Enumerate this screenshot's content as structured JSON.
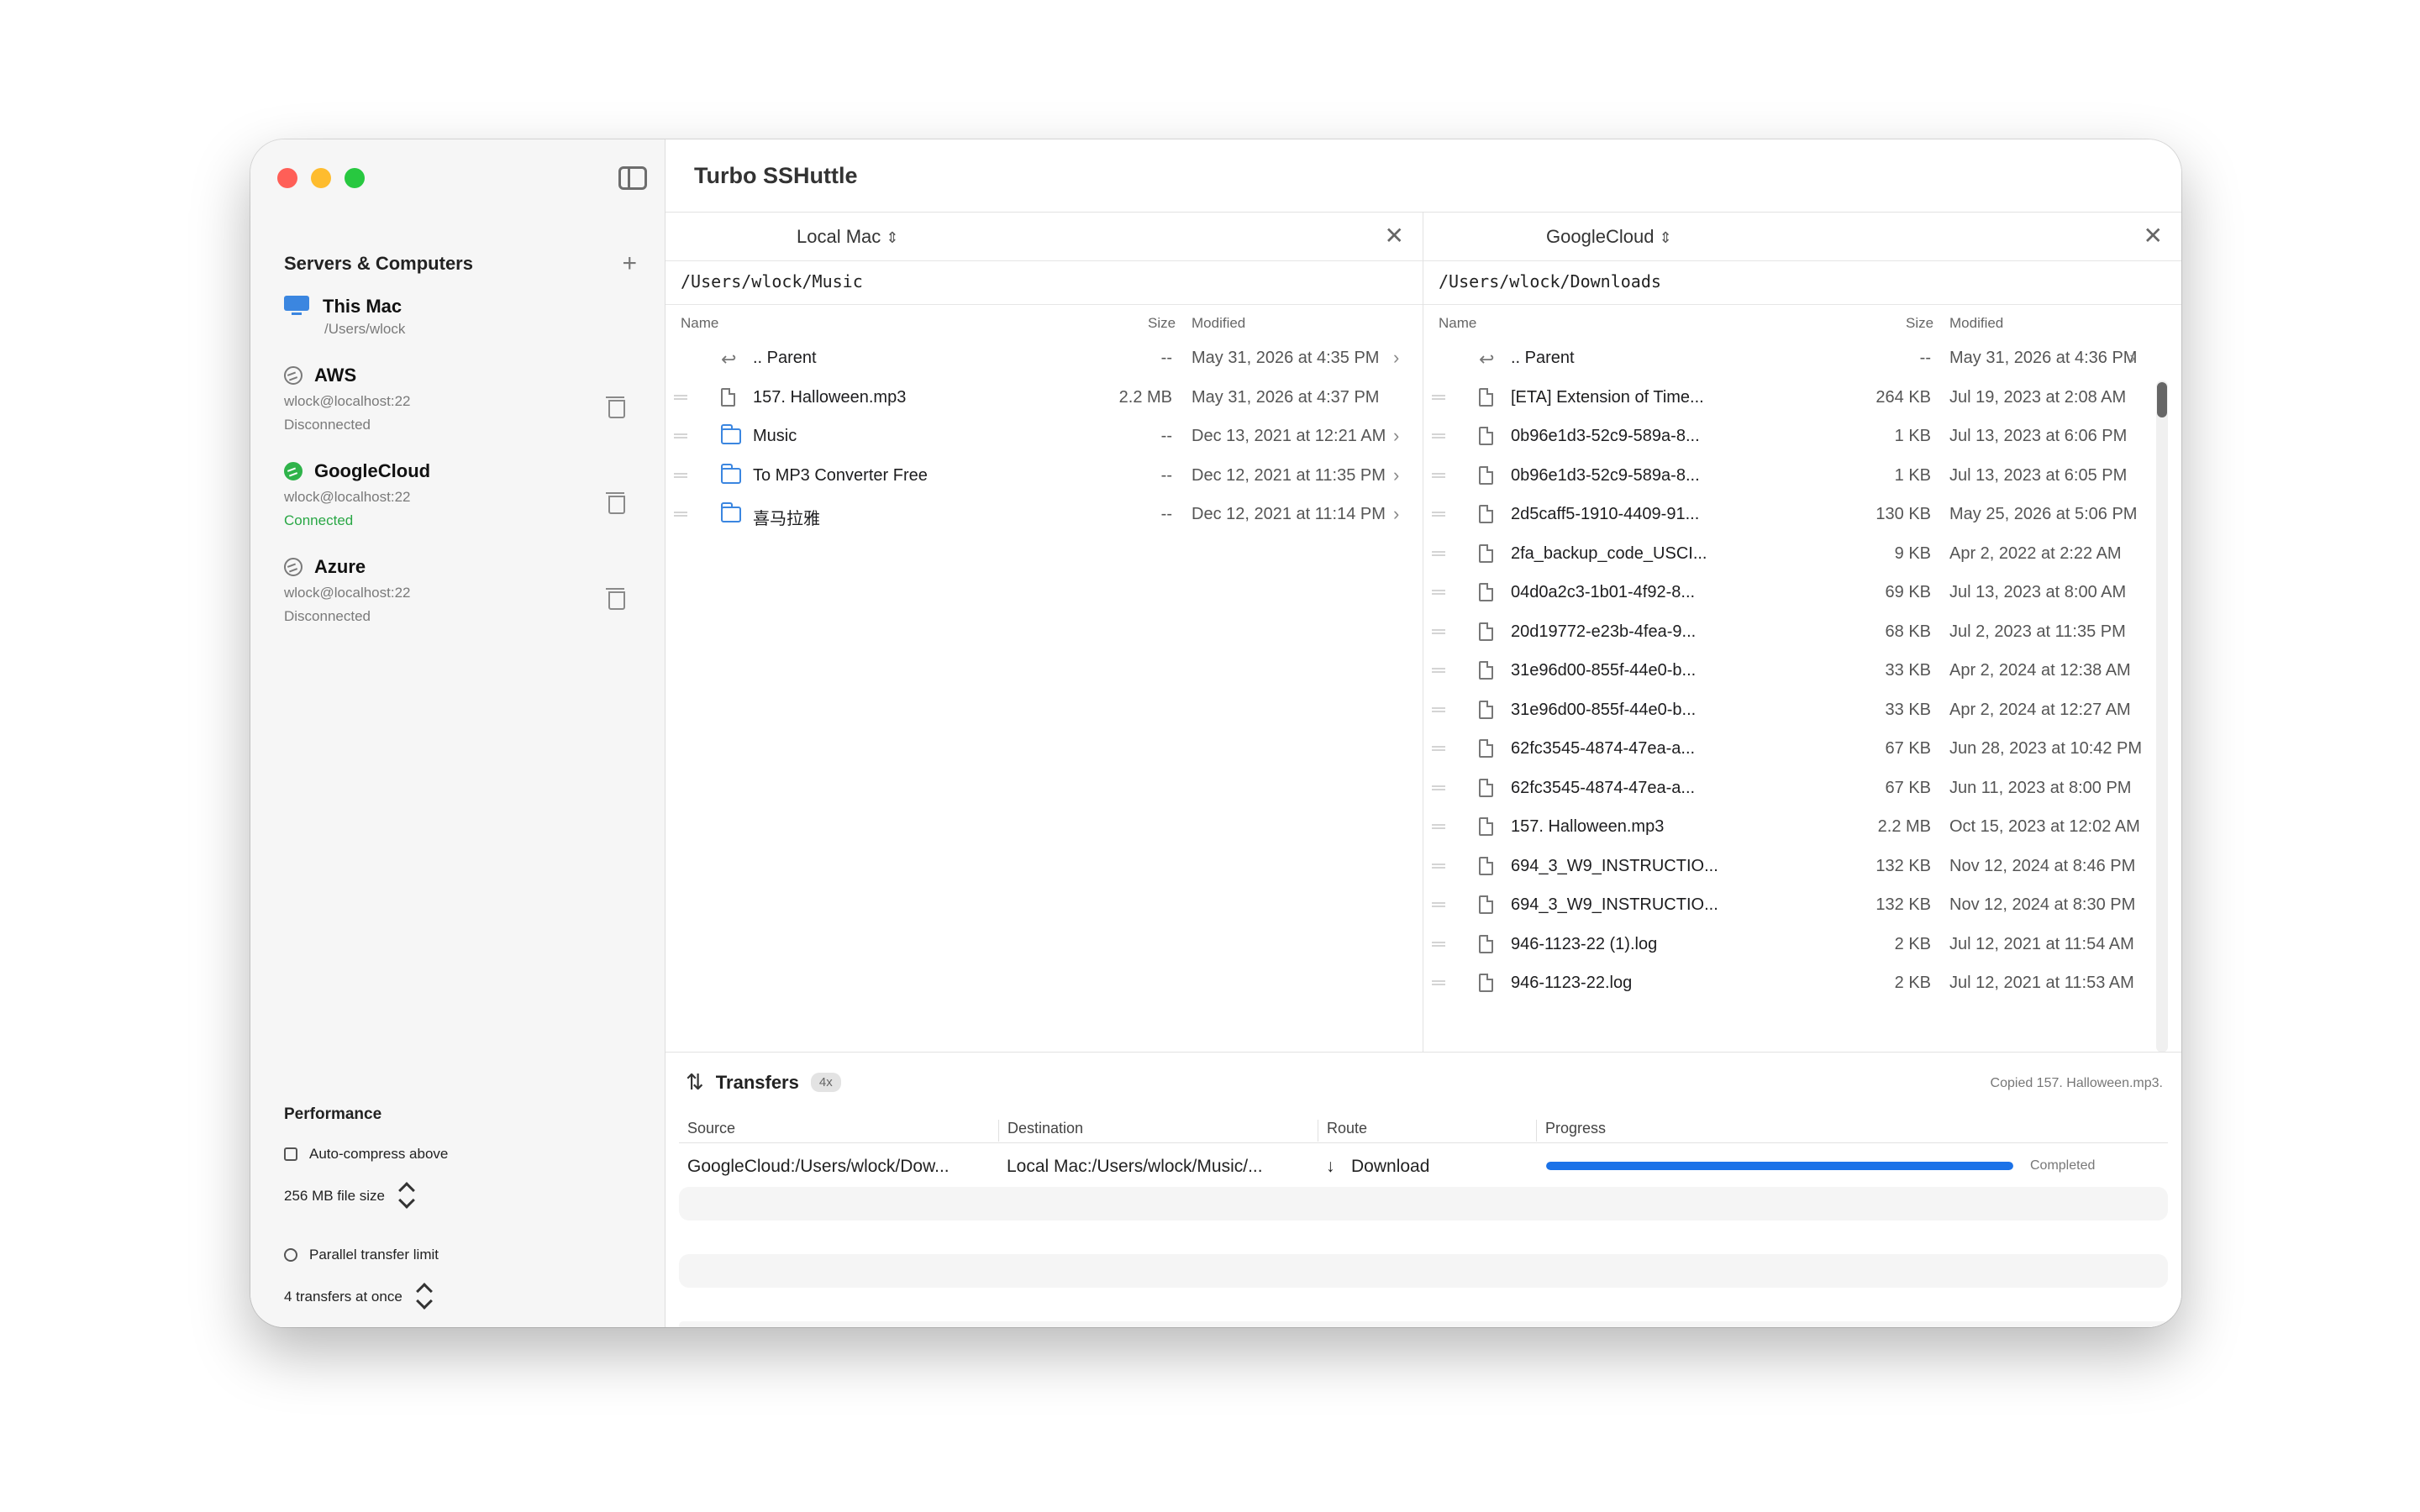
{
  "app": {
    "title": "Turbo SSHuttle"
  },
  "sidebar": {
    "section_title": "Servers & Computers",
    "add_label": "+",
    "servers": [
      {
        "name": "This Mac",
        "detail": "/Users/wlock",
        "status": "",
        "icon": "monitor-icon"
      },
      {
        "name": "AWS",
        "detail": "wlock@localhost:22",
        "status": "Disconnected",
        "icon": "disconnected-icon"
      },
      {
        "name": "GoogleCloud",
        "detail": "wlock@localhost:22",
        "status": "Connected",
        "icon": "connected-icon",
        "status_color": "#29a745"
      },
      {
        "name": "Azure",
        "detail": "wlock@localhost:22",
        "status": "Disconnected",
        "icon": "disconnected-icon"
      }
    ],
    "performance": {
      "title": "Performance",
      "compress_label": "Auto-compress above",
      "compress_value": "256 MB file size",
      "parallel_label": "Parallel transfer limit",
      "parallel_value": "4 transfers at once"
    }
  },
  "left_pane": {
    "host": "Local Mac",
    "path": "/Users/wlock/Music",
    "columns": {
      "name": "Name",
      "size": "Size",
      "modified": "Modified"
    },
    "rows": [
      {
        "type": "parent",
        "name": ".. Parent",
        "size": "--",
        "modified": "May 31, 2026 at 4:35 PM",
        "chevron": true
      },
      {
        "type": "file",
        "name": "157. Halloween.mp3",
        "size": "2.2 MB",
        "modified": "May 31, 2026 at 4:37 PM",
        "chevron": false
      },
      {
        "type": "folder",
        "name": "Music",
        "size": "--",
        "modified": "Dec 13, 2021 at 12:21 AM",
        "chevron": true
      },
      {
        "type": "folder",
        "name": "To MP3 Converter Free",
        "size": "--",
        "modified": "Dec 12, 2021 at 11:35 PM",
        "chevron": true
      },
      {
        "type": "folder",
        "name": "喜马拉雅",
        "size": "--",
        "modified": "Dec 12, 2021 at 11:14 PM",
        "chevron": true
      }
    ]
  },
  "right_pane": {
    "host": "GoogleCloud",
    "path": "/Users/wlock/Downloads",
    "columns": {
      "name": "Name",
      "size": "Size",
      "modified": "Modified"
    },
    "rows": [
      {
        "type": "parent",
        "name": ".. Parent",
        "size": "--",
        "modified": "May 31, 2026 at 4:36 PM",
        "chevron": true
      },
      {
        "type": "file",
        "name": "[ETA] Extension of Time...",
        "size": "264 KB",
        "modified": "Jul 19, 2023 at 2:08 AM"
      },
      {
        "type": "file",
        "name": "0b96e1d3-52c9-589a-8...",
        "size": "1 KB",
        "modified": "Jul 13, 2023 at 6:06 PM"
      },
      {
        "type": "file",
        "name": "0b96e1d3-52c9-589a-8...",
        "size": "1 KB",
        "modified": "Jul 13, 2023 at 6:05 PM"
      },
      {
        "type": "file",
        "name": "2d5caff5-1910-4409-91...",
        "size": "130 KB",
        "modified": "May 25, 2026 at 5:06 PM"
      },
      {
        "type": "file",
        "name": "2fa_backup_code_USCI...",
        "size": "9 KB",
        "modified": "Apr 2, 2022 at 2:22 AM"
      },
      {
        "type": "file",
        "name": "04d0a2c3-1b01-4f92-8...",
        "size": "69 KB",
        "modified": "Jul 13, 2023 at 8:00 AM"
      },
      {
        "type": "file",
        "name": "20d19772-e23b-4fea-9...",
        "size": "68 KB",
        "modified": "Jul 2, 2023 at 11:35 PM"
      },
      {
        "type": "file",
        "name": "31e96d00-855f-44e0-b...",
        "size": "33 KB",
        "modified": "Apr 2, 2024 at 12:38 AM"
      },
      {
        "type": "file",
        "name": "31e96d00-855f-44e0-b...",
        "size": "33 KB",
        "modified": "Apr 2, 2024 at 12:27 AM"
      },
      {
        "type": "file",
        "name": "62fc3545-4874-47ea-a...",
        "size": "67 KB",
        "modified": "Jun 28, 2023 at 10:42 PM"
      },
      {
        "type": "file",
        "name": "62fc3545-4874-47ea-a...",
        "size": "67 KB",
        "modified": "Jun 11, 2023 at 8:00 PM"
      },
      {
        "type": "file",
        "name": "157. Halloween.mp3",
        "size": "2.2 MB",
        "modified": "Oct 15, 2023 at 12:02 AM"
      },
      {
        "type": "file",
        "name": "694_3_W9_INSTRUCTIO...",
        "size": "132 KB",
        "modified": "Nov 12, 2024 at 8:46 PM"
      },
      {
        "type": "file",
        "name": "694_3_W9_INSTRUCTIO...",
        "size": "132 KB",
        "modified": "Nov 12, 2024 at 8:30 PM"
      },
      {
        "type": "file",
        "name": "946-1123-22 (1).log",
        "size": "2 KB",
        "modified": "Jul 12, 2021 at 11:54 AM"
      },
      {
        "type": "file",
        "name": "946-1123-22.log",
        "size": "2 KB",
        "modified": "Jul 12, 2021 at 11:53 AM"
      }
    ]
  },
  "transfers": {
    "title": "Transfers",
    "badge": "4x",
    "message": "Copied 157. Halloween.mp3.",
    "columns": {
      "source": "Source",
      "destination": "Destination",
      "route": "Route",
      "progress": "Progress"
    },
    "rows": [
      {
        "source": "GoogleCloud:/Users/wlock/Dow...",
        "destination": "Local Mac:/Users/wlock/Music/...",
        "route": "Download",
        "progress": 1.0,
        "status": "Completed"
      }
    ],
    "accent": "#1b72e8"
  }
}
